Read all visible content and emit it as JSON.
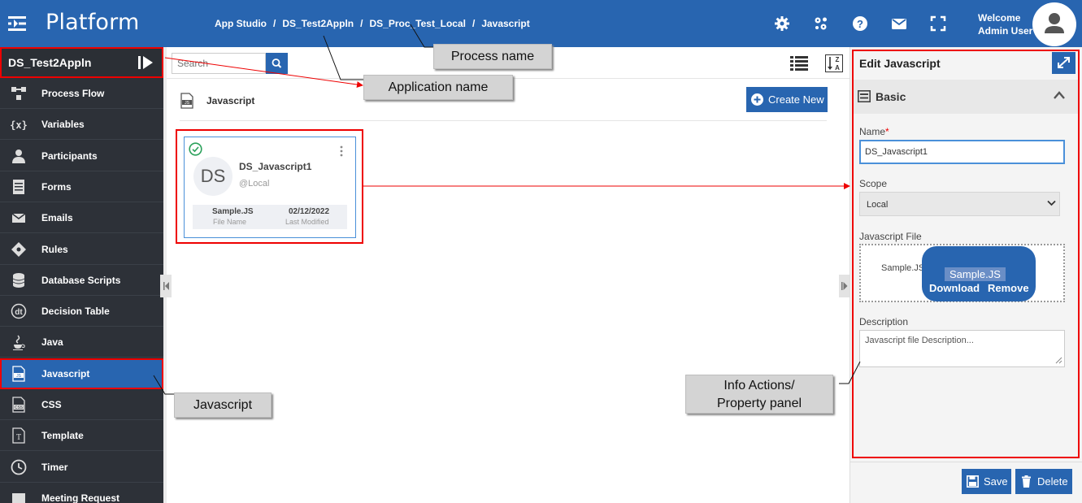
{
  "header": {
    "brand": "Platform",
    "breadcrumb": [
      "App Studio",
      "DS_Test2Appln",
      "DS_Proc_Test_Local",
      "Javascript"
    ],
    "welcome": "Welcome",
    "user": "Admin User"
  },
  "sidebar": {
    "app_name": "DS_Test2Appln",
    "items": [
      {
        "label": "Process Flow",
        "icon": "process-flow-icon"
      },
      {
        "label": "Variables",
        "icon": "variables-icon"
      },
      {
        "label": "Participants",
        "icon": "participants-icon"
      },
      {
        "label": "Forms",
        "icon": "forms-icon"
      },
      {
        "label": "Emails",
        "icon": "emails-icon"
      },
      {
        "label": "Rules",
        "icon": "rules-icon"
      },
      {
        "label": "Database Scripts",
        "icon": "database-icon"
      },
      {
        "label": "Decision Table",
        "icon": "decision-table-icon"
      },
      {
        "label": "Java",
        "icon": "java-icon"
      },
      {
        "label": "Javascript",
        "icon": "javascript-icon",
        "active": true
      },
      {
        "label": "CSS",
        "icon": "css-icon"
      },
      {
        "label": "Template",
        "icon": "template-icon"
      },
      {
        "label": "Timer",
        "icon": "timer-icon"
      },
      {
        "label": "Meeting Request",
        "icon": "meeting-icon"
      }
    ]
  },
  "main": {
    "search_placeholder": "Search",
    "section_title": "Javascript",
    "create_label": "Create New",
    "card": {
      "initials": "DS",
      "name": "DS_Javascript1",
      "scope": "@Local",
      "file_name": "Sample.JS",
      "file_name_label": "File Name",
      "modified": "02/12/2022",
      "modified_label": "Last Modified"
    }
  },
  "panel": {
    "title": "Edit Javascript",
    "section": "Basic",
    "name_label": "Name",
    "required_mark": "*",
    "name_value": "DS_Javascript1",
    "scope_label": "Scope",
    "scope_value": "Local",
    "file_label": "Javascript File",
    "file_name": "Sample.JS",
    "file_name_short": "Sample.JS",
    "download": "Download",
    "remove": "Remove",
    "description_label": "Description",
    "description_placeholder": "Javascript file Description...",
    "save": "Save",
    "delete": "Delete"
  },
  "callouts": {
    "process": "Process name",
    "application": "Application name",
    "javascript": "Javascript",
    "info_line1": "Info Actions/",
    "info_line2": "Property panel"
  },
  "colors": {
    "primary": "#2865b0",
    "sidebar": "#2d3138",
    "annotation": "#e00000"
  }
}
